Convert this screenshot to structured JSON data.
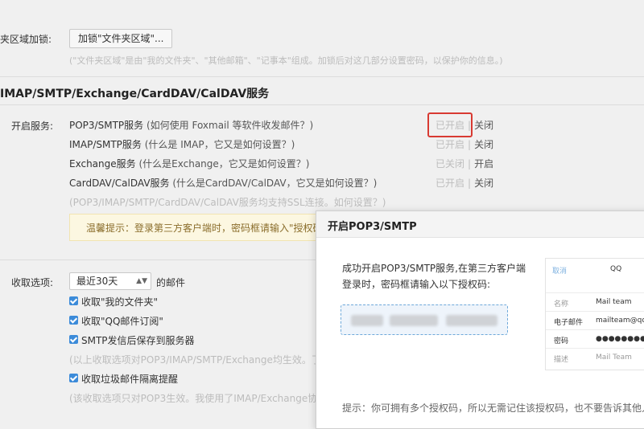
{
  "folder_lock": {
    "label": "夹区域加锁:",
    "button": "加锁\"文件夹区域\"...",
    "hint": "(\"文件夹区域\"是由\"我的文件夹\"、\"其他邮箱\"、\"记事本\"组成。加锁后对这几部分设置密码，以保护你的信息。)"
  },
  "section_title": "IMAP/SMTP/Exchange/CardDAV/CalDAV服务",
  "services": {
    "label": "开启服务:",
    "rows": [
      {
        "name": "POP3/SMTP服务",
        "help": "(如何使用 Foxmail 等软件收发邮件？)",
        "state": "已开启",
        "sep": "|",
        "action": "关闭"
      },
      {
        "name": "IMAP/SMTP服务",
        "help": "(什么是 IMAP，它又是如何设置？)",
        "state": "已开启",
        "sep": "|",
        "action": "关闭"
      },
      {
        "name": "Exchange服务",
        "help": "(什么是Exchange，它又是如何设置？)",
        "state": "已关闭",
        "sep": "|",
        "action": "开启"
      },
      {
        "name": "CardDAV/CalDAV服务",
        "help": "(什么是CardDAV/CalDAV，它又是如何设置？)",
        "state": "已开启",
        "sep": "|",
        "action": "关闭"
      }
    ],
    "ssl_note": "(POP3/IMAP/SMTP/CardDAV/CalDAV服务均支持SSL连接。如何设置？)",
    "tip": "温馨提示：登录第三方客户端时，密码框请输入\"授权码"
  },
  "receive": {
    "label": "收取选项:",
    "select_value": "最近30天",
    "select_suffix": "的邮件",
    "options": [
      "收取\"我的文件夹\"",
      "收取\"QQ邮件订阅\"",
      "SMTP发信后保存到服务器"
    ],
    "note1": "(以上收取选项对POP3/IMAP/SMTP/Exchange均生效。了",
    "junk_option": "收取垃圾邮件隔离提醒",
    "note2": "(该收取选项只对POP3生效。我使用了IMAP/Exchange协"
  },
  "dialog": {
    "title": "开启POP3/SMTP",
    "message_line1": "成功开启POP3/SMTP服务,在第三方客户端",
    "message_line2": "登录时，密码框请输入以下授权码:",
    "footer": "提示：你可拥有多个授权码，所以无需记住该授权码，也不要告诉其他人。",
    "card": {
      "tab1": "取消",
      "tab2": "QQ",
      "rows": [
        {
          "k": "名称",
          "v": "Mail team"
        },
        {
          "k": "电子邮件",
          "v": "mailteam@qq.c"
        },
        {
          "k": "密码",
          "v": "●●●●●●●●●●●●"
        },
        {
          "k": "描述",
          "v": "Mail Team"
        }
      ]
    }
  }
}
